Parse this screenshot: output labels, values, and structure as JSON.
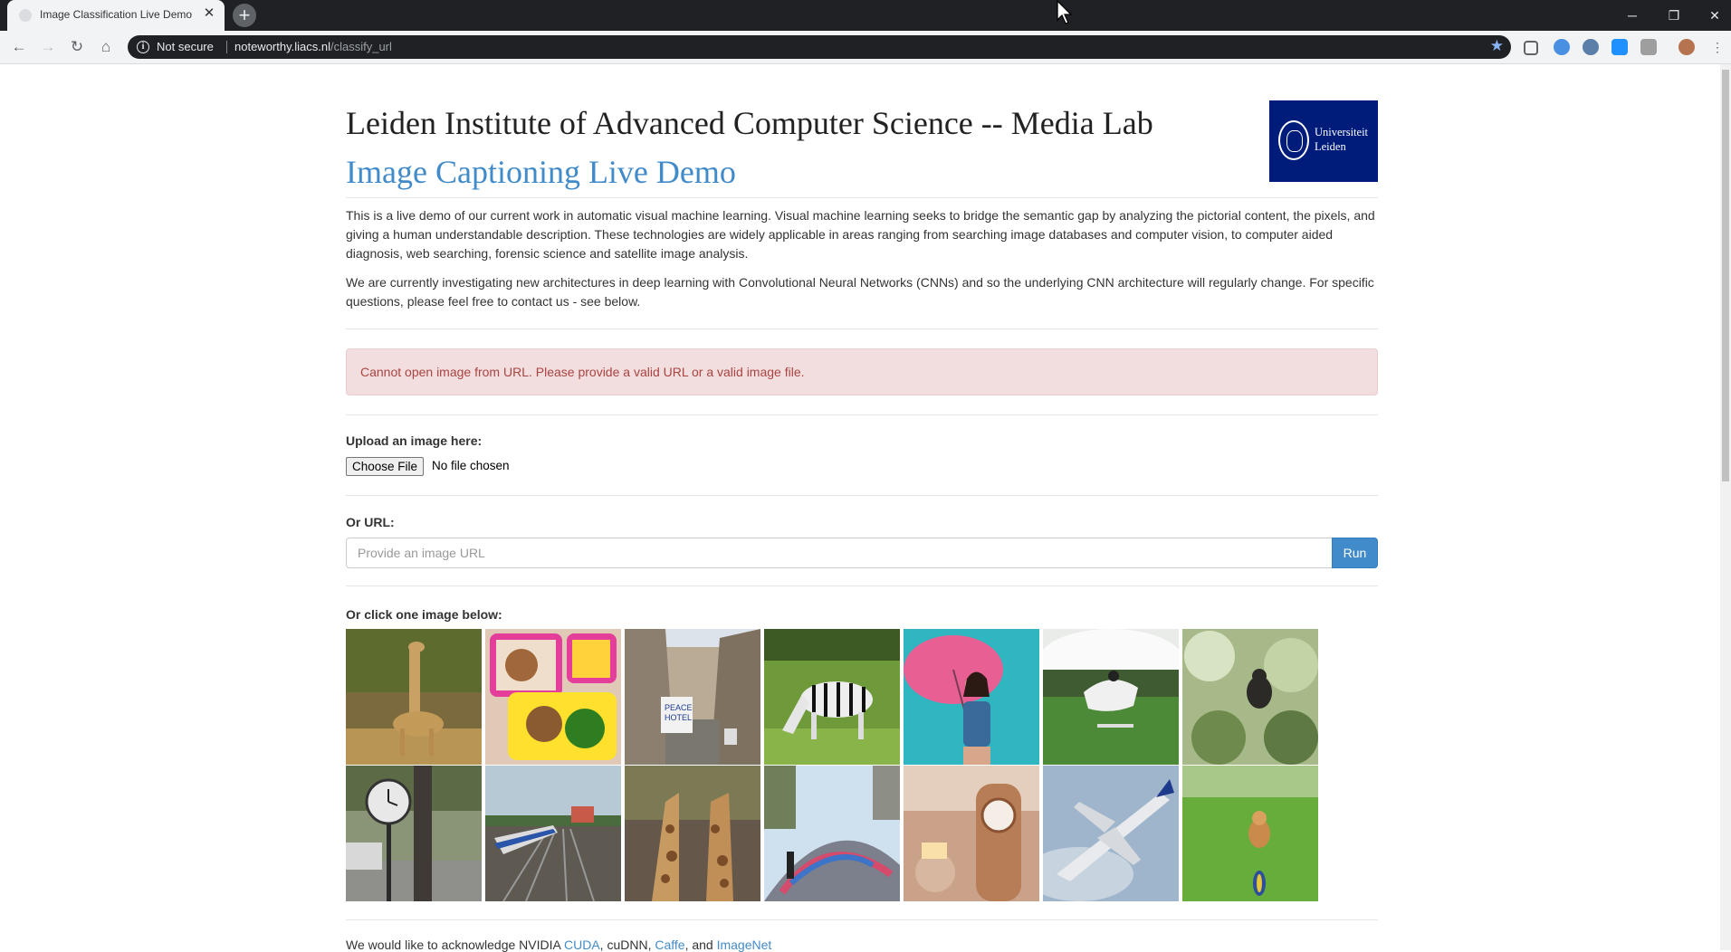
{
  "browser": {
    "tab_title": "Image Classification Live Demo",
    "security_label": "Not secure",
    "url_host": "noteworthy.liacs.nl",
    "url_path": "/classify_url"
  },
  "page": {
    "heading": "Leiden Institute of Advanced Computer Science -- Media Lab",
    "subheading": "Image Captioning Live Demo",
    "logo_text_line1": "Universiteit",
    "logo_text_line2": "Leiden",
    "intro_paragraph": "This is a live demo of our current work in automatic visual machine learning. Visual machine learning seeks to bridge the semantic gap by analyzing the pictorial content, the pixels, and giving a human understandable description. These technologies are widely applicable in areas ranging from searching image databases and computer vision, to computer aided diagnosis, web searching, forensic science and satellite image analysis.",
    "research_paragraph": "We are currently investigating new architectures in deep learning with Convolutional Neural Networks (CNNs) and so the underlying CNN architecture will regularly change. For specific questions, please feel free to contact us - see below.",
    "error_message": "Cannot open image from URL. Please provide a valid URL or a valid image file.",
    "upload_label": "Upload an image here:",
    "choose_file_label": "Choose File",
    "file_status": "No file chosen",
    "url_label": "Or URL:",
    "url_placeholder": "Provide an image URL",
    "run_label": "Run",
    "examples_label": "Or click one image below:",
    "ack_prefix": "We would like to acknowledge NVIDIA",
    "ack_cuda": "CUDA",
    "ack_cudnn": "cuDNN",
    "ack_caffe": "Caffe",
    "ack_and": "and",
    "ack_imagenet": "ImageNet"
  },
  "example_images": [
    {
      "subject": "giraffe"
    },
    {
      "subject": "bento-box"
    },
    {
      "subject": "street-hotel"
    },
    {
      "subject": "zebra"
    },
    {
      "subject": "woman-umbrella"
    },
    {
      "subject": "horse-jump"
    },
    {
      "subject": "gorilla-jungle"
    },
    {
      "subject": "street-clock"
    },
    {
      "subject": "train-tracks"
    },
    {
      "subject": "giraffes-pair"
    },
    {
      "subject": "skatepark"
    },
    {
      "subject": "mantel-clock"
    },
    {
      "subject": "airplane"
    },
    {
      "subject": "dog-grass"
    }
  ],
  "colors": {
    "link": "#428bca",
    "alert_bg": "#f2dede",
    "alert_text": "#a94442",
    "logo_bg": "#001c7a"
  }
}
